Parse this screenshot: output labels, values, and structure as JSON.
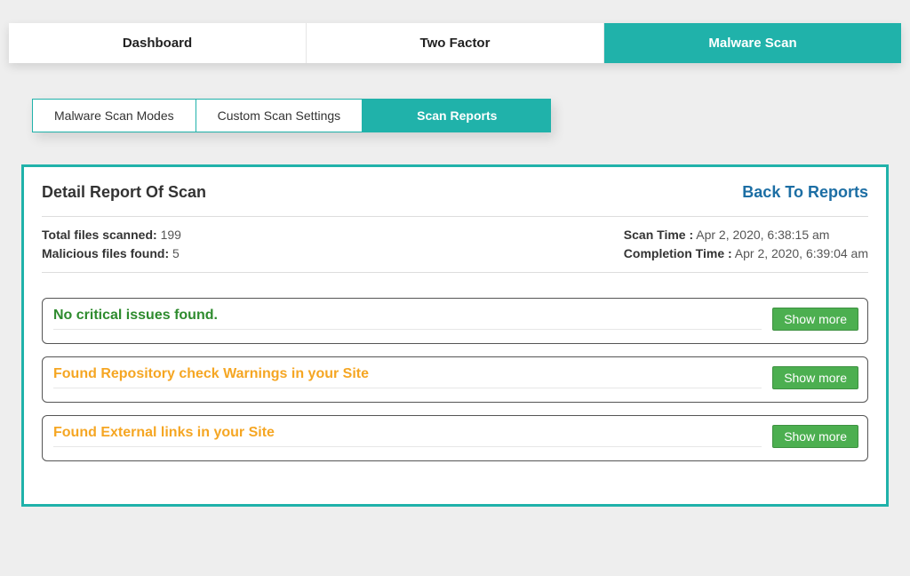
{
  "mainTabs": {
    "dashboard": "Dashboard",
    "twoFactor": "Two Factor",
    "malwareScan": "Malware Scan"
  },
  "subTabs": {
    "modes": "Malware Scan Modes",
    "custom": "Custom Scan Settings",
    "reports": "Scan Reports"
  },
  "panel": {
    "title": "Detail Report Of Scan",
    "backLink": "Back To Reports"
  },
  "summary": {
    "totalLabel": "Total files scanned:",
    "totalValue": "199",
    "maliciousLabel": "Malicious files found:",
    "maliciousValue": "5",
    "scanTimeLabel": "Scan Time :",
    "scanTimeValue": "Apr 2, 2020, 6:38:15 am",
    "completionLabel": "Completion Time :",
    "completionValue": "Apr 2, 2020, 6:39:04 am"
  },
  "issues": {
    "ok": "No critical issues found.",
    "repo": "Found Repository check Warnings in your Site",
    "external": "Found External links in your Site",
    "showMore": "Show more"
  }
}
